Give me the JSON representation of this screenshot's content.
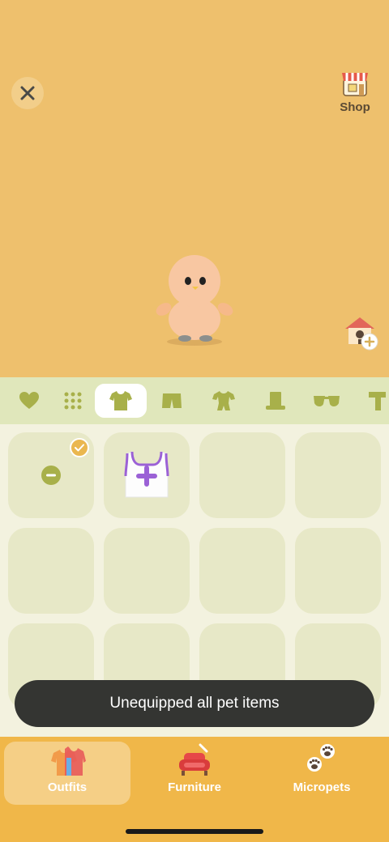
{
  "header": {
    "shop_label": "Shop"
  },
  "tabs": [
    {
      "name": "favorites"
    },
    {
      "name": "all"
    },
    {
      "name": "tops",
      "active": true
    },
    {
      "name": "bottoms"
    },
    {
      "name": "onesies"
    },
    {
      "name": "hats"
    },
    {
      "name": "glasses"
    },
    {
      "name": "scarves"
    }
  ],
  "toast": {
    "message": "Unequipped all pet items"
  },
  "bottom_nav": {
    "items": [
      {
        "label": "Outfits",
        "active": true
      },
      {
        "label": "Furniture"
      },
      {
        "label": "Micropets"
      }
    ]
  },
  "colors": {
    "scene_bg": "#eec06d",
    "tab_bar": "#e0e7bb",
    "tab_icon": "#a8b04a",
    "cell": "#e7e8c7",
    "bottom_nav": "#f0b749",
    "toast_bg": "#343532"
  }
}
